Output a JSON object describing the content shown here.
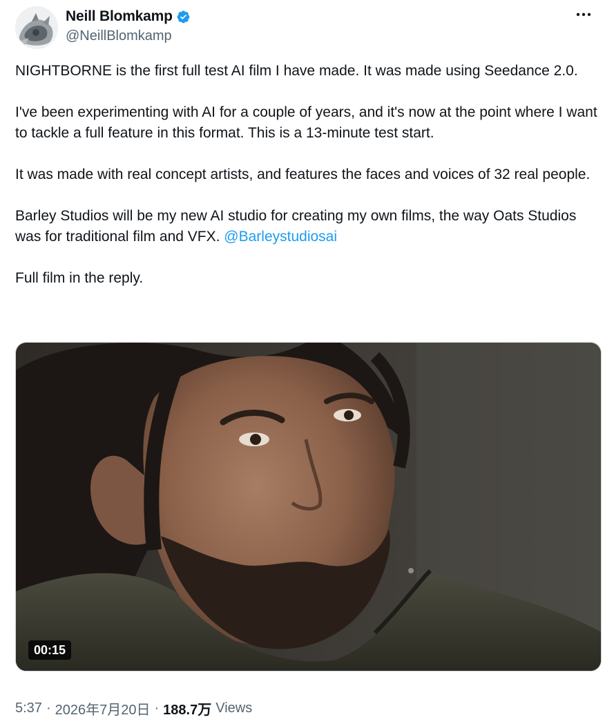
{
  "author": {
    "display_name": "Neill Blomkamp",
    "handle": "@NeillBlomkamp",
    "verified": true,
    "avatar_icon": "avatar-image",
    "verified_icon": "verified-badge-icon",
    "badge_color": "#1d9bf0"
  },
  "more_icon": "more-options-icon",
  "tweet": {
    "paragraphs": [
      "NIGHTBORNE is the first full test AI film I have made. It was made using Seedance 2.0.",
      "I've been experimenting with AI for a couple of years, and it's now at the point where I want to tackle a full feature in this format. This is a 13-minute test start.",
      "It was made with real concept artists, and features the faces and voices of 32 real people."
    ],
    "paragraph4_text": "Barley Studios will be my new AI studio for creating my own films, the way Oats Studios was for traditional film and VFX. ",
    "mention": "@Barleystudiosai",
    "paragraph5": "Full film in the reply."
  },
  "media": {
    "type": "video",
    "duration": "00:15"
  },
  "meta": {
    "time": "5:37",
    "separator": "·",
    "date": "2026年7月20日",
    "views_count": "188.7万",
    "views_label": "Views"
  },
  "colors": {
    "text": "#0f1419",
    "secondary": "#536471",
    "link": "#1d9bf0"
  }
}
